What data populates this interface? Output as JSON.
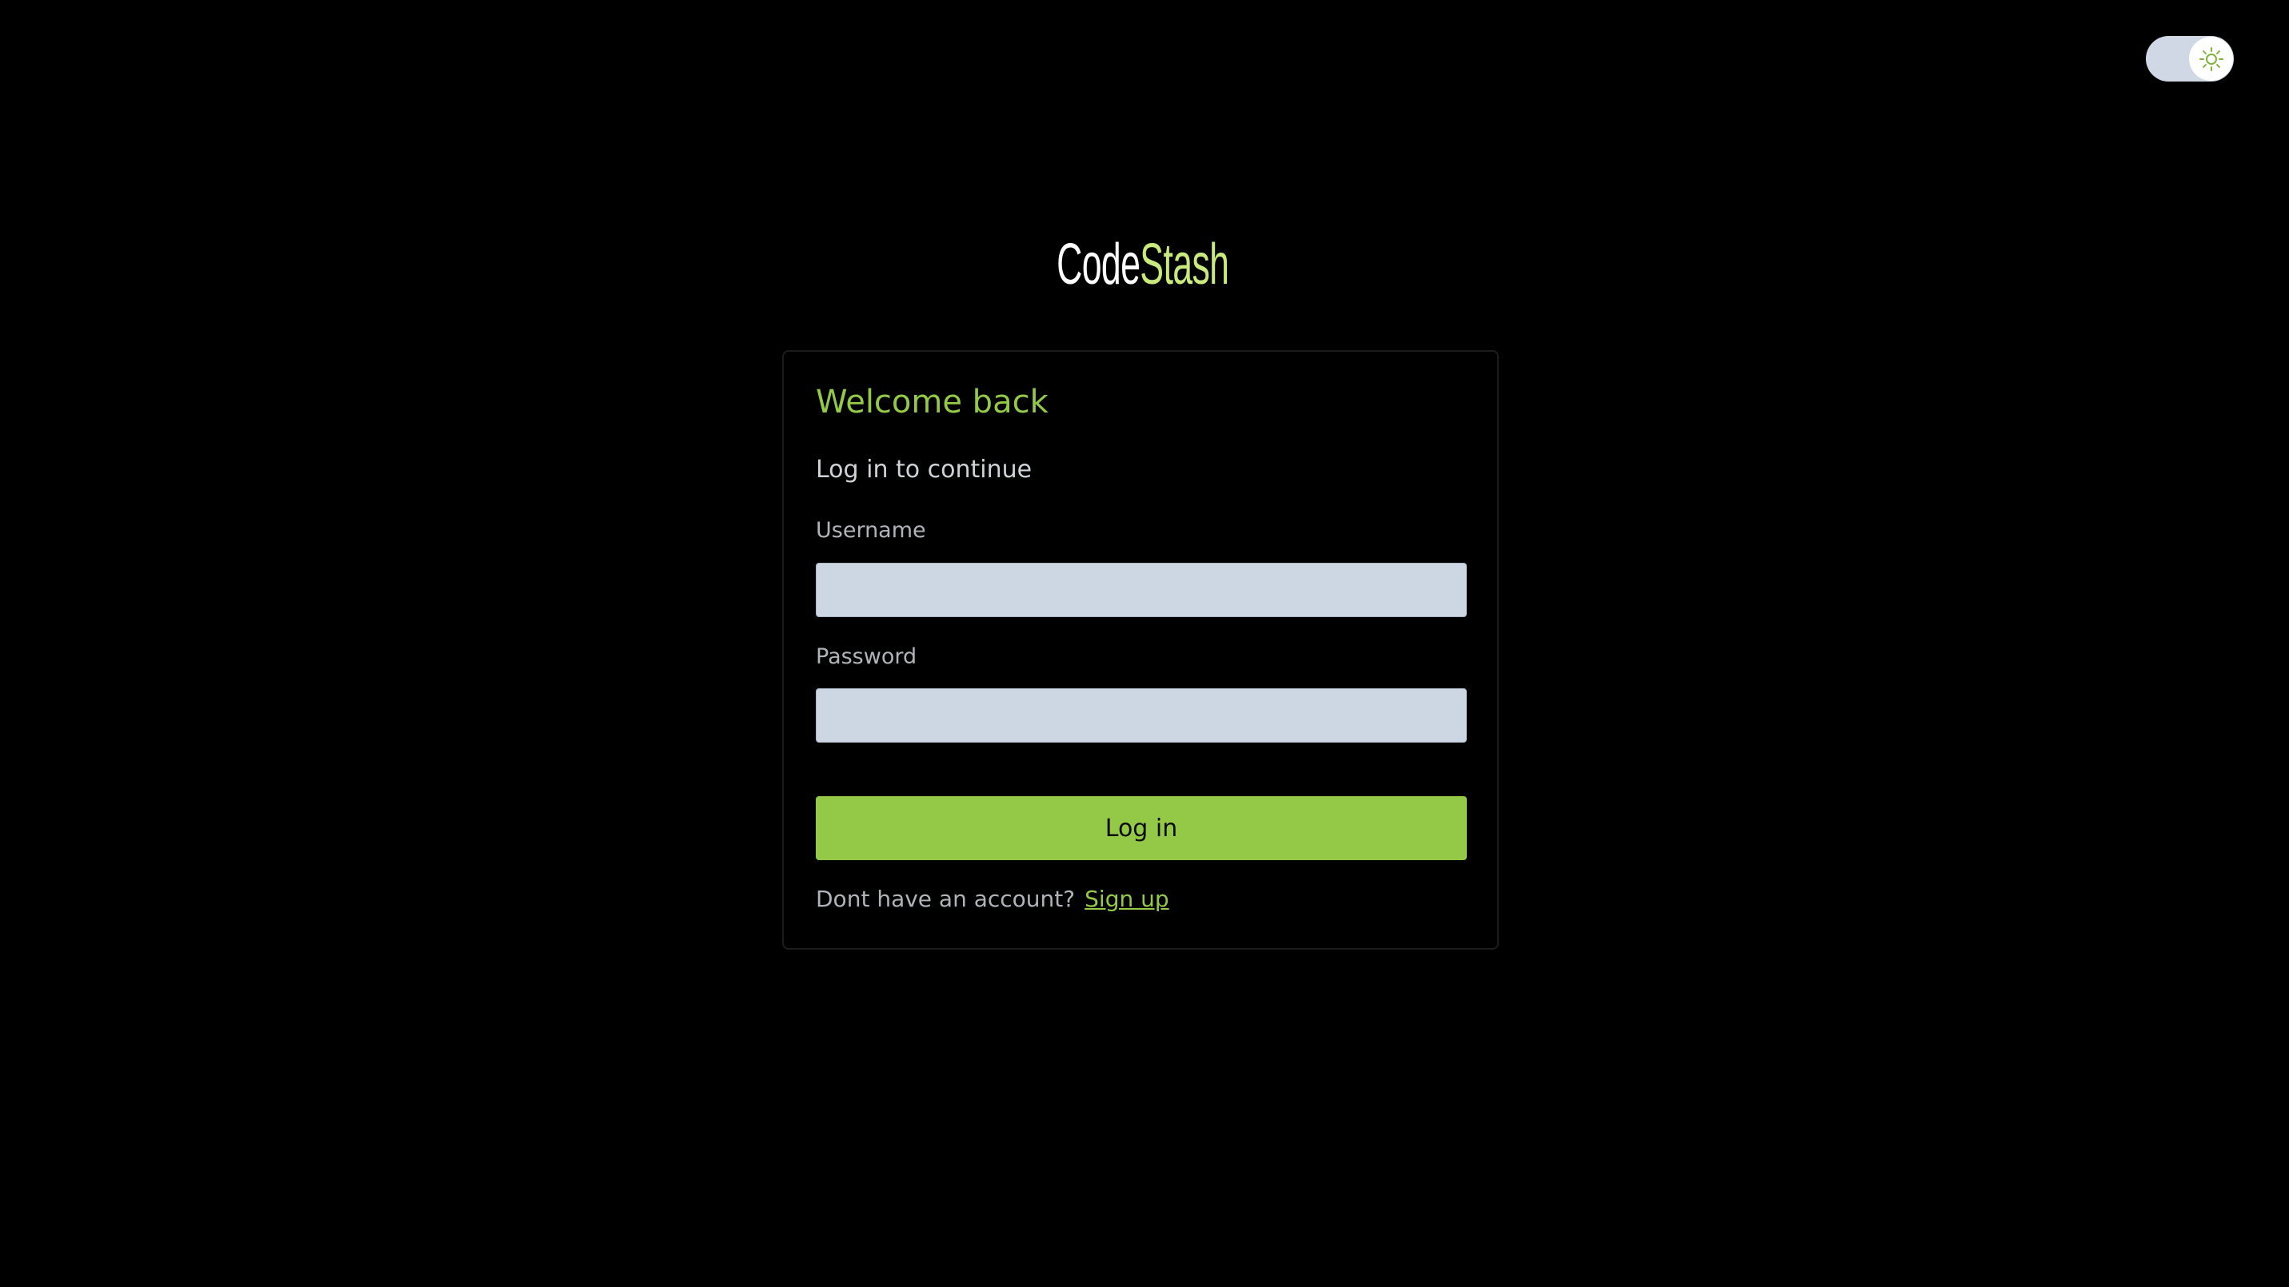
{
  "theme_toggle": {
    "icon": "sun-icon",
    "accent_color": "#94c947"
  },
  "logo": {
    "part1": "Code",
    "part2": "Stash",
    "part1_color": "#ffffff",
    "part2_color": "#c8ea7c"
  },
  "login_card": {
    "title": "Welcome back",
    "subtitle": "Log in to continue",
    "username_label": "Username",
    "username_value": "",
    "password_label": "Password",
    "password_value": "",
    "login_button_label": "Log in",
    "signup_prompt": "Dont have an account?",
    "signup_link_label": "Sign up"
  },
  "colors": {
    "background": "#000000",
    "accent": "#94c947",
    "input_background": "#cdd6e3"
  }
}
